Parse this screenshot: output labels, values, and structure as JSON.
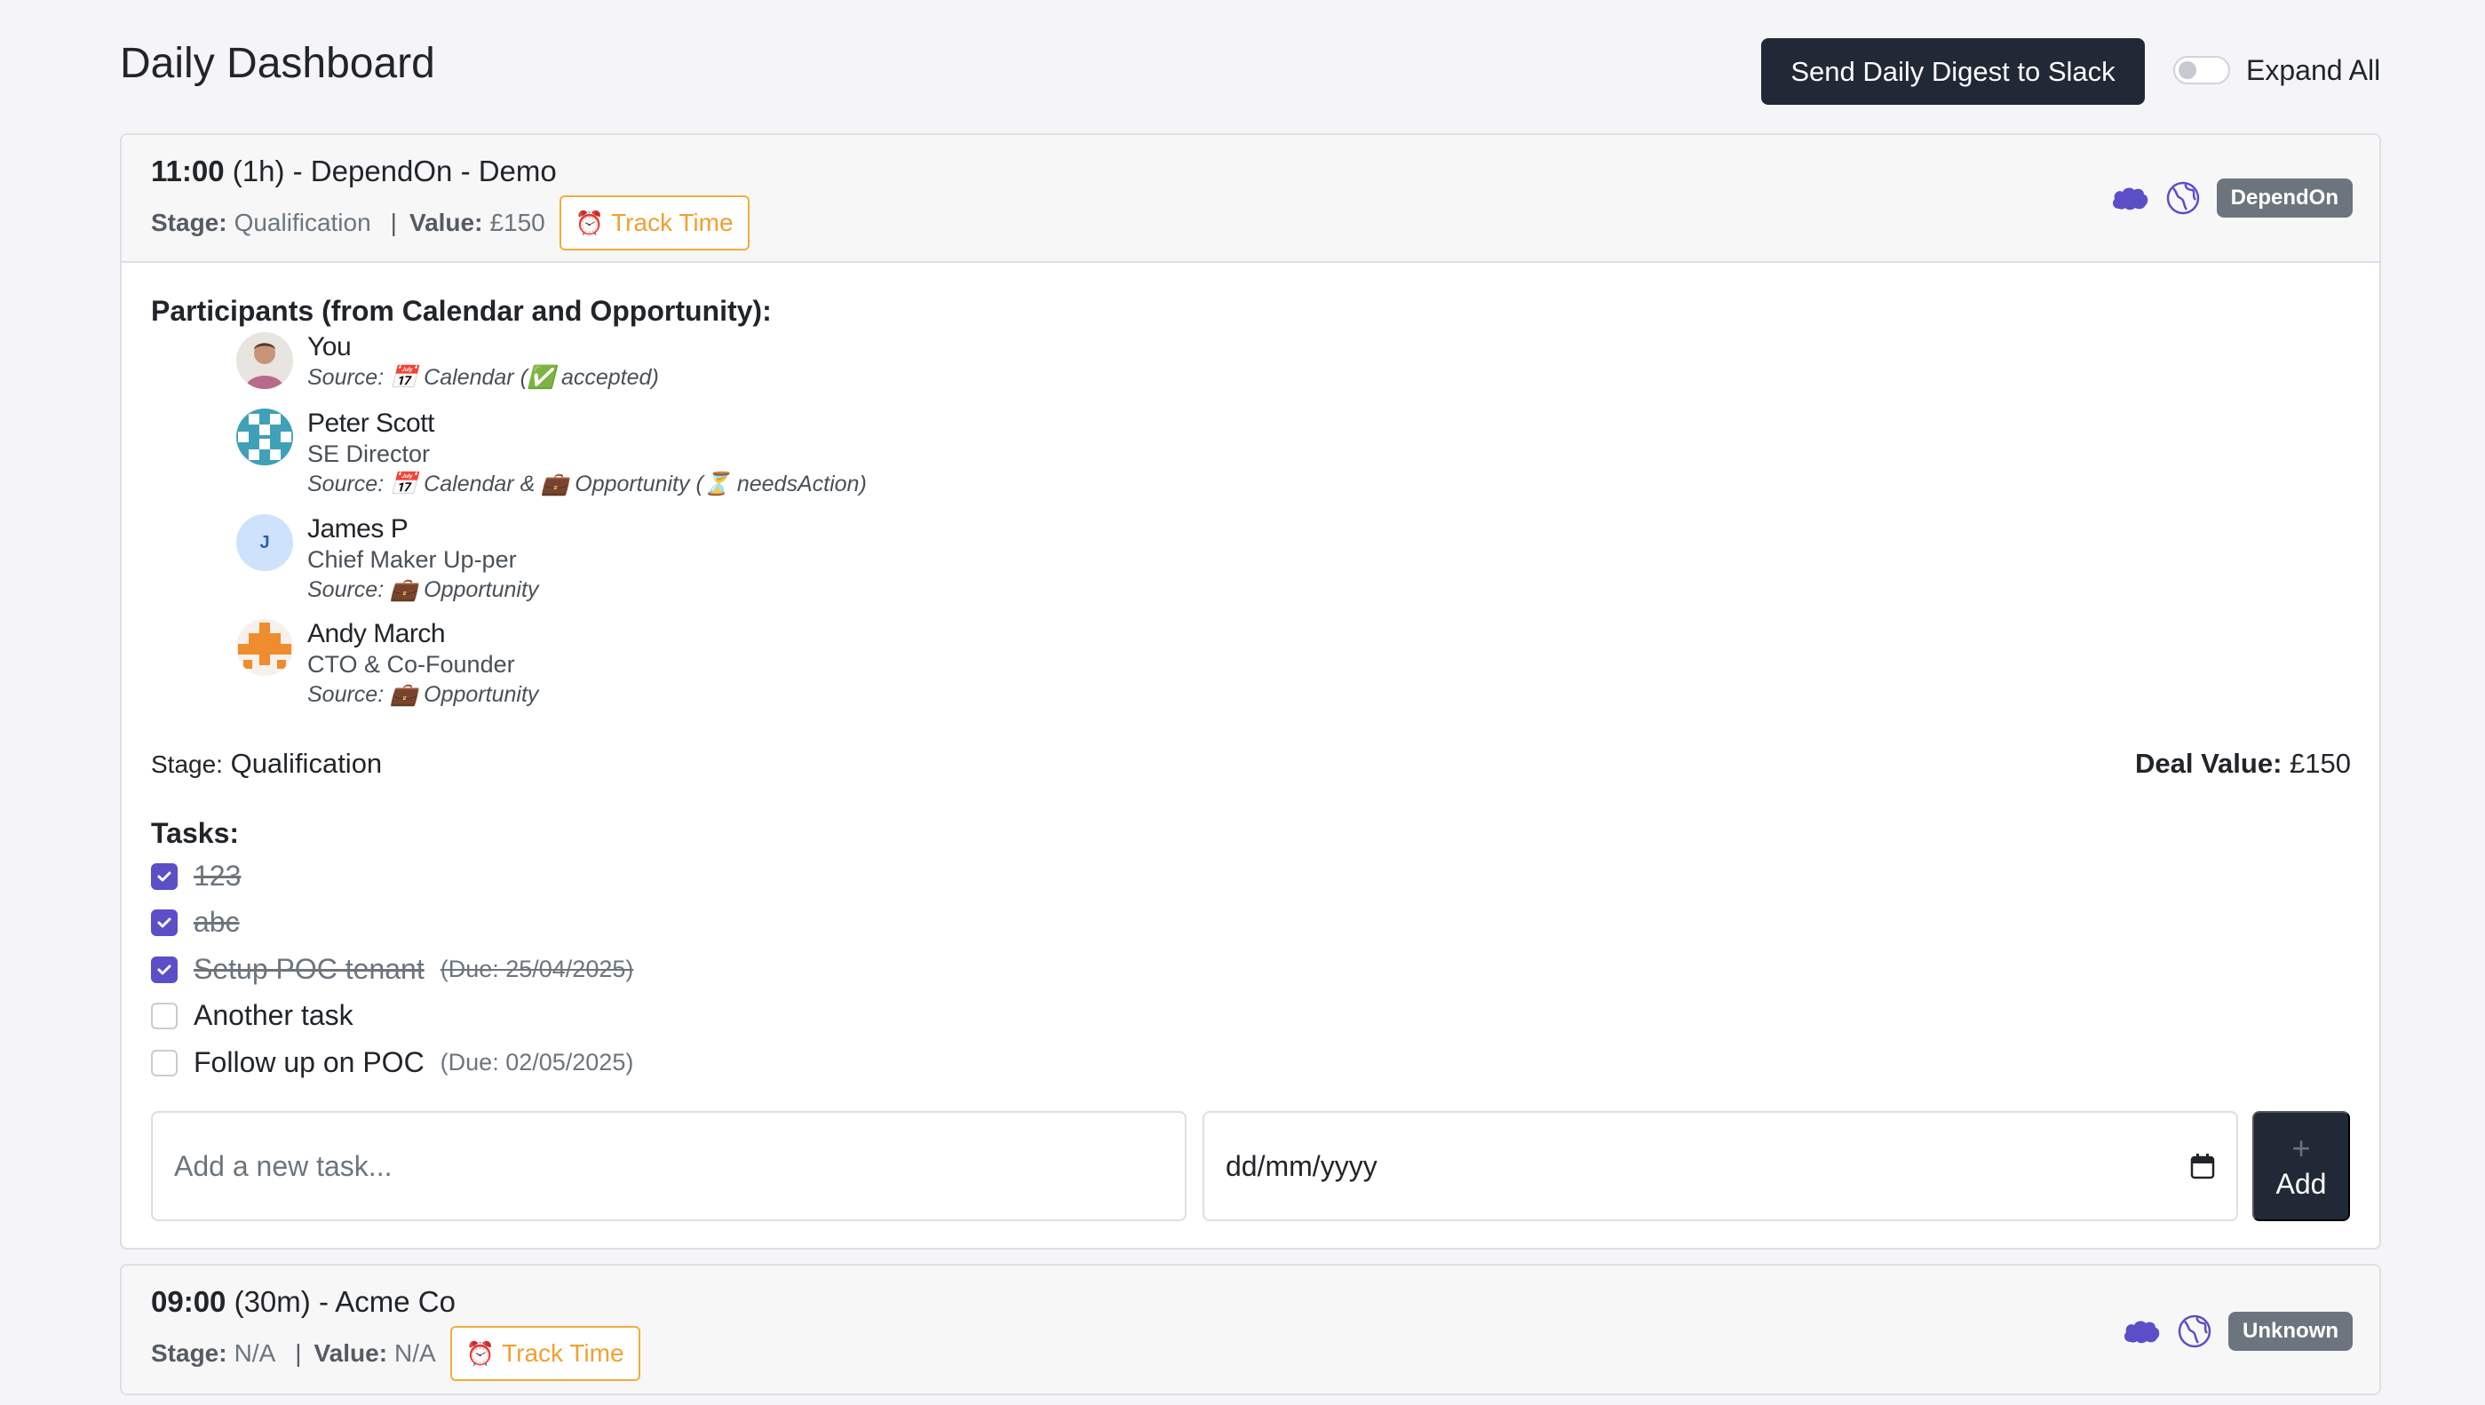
{
  "page": {
    "title": "Daily Dashboard",
    "digest_button": "Send Daily Digest to Slack",
    "expand_all_label": "Expand All",
    "expand_all_on": false
  },
  "meetings": [
    {
      "time": "11:00",
      "duration": "(1h)",
      "name": "- DependOn - Demo",
      "stage_label": "Stage:",
      "stage": "Qualification",
      "sep": "|",
      "value_label": "Value:",
      "value": "£150",
      "track_label": "Track Time",
      "account_badge": "DependOn",
      "participants_title": "Participants (from Calendar and Opportunity):",
      "participants": [
        {
          "name": "You",
          "role": "",
          "source": "Source: 📅 Calendar (✅ accepted)"
        },
        {
          "name": "Peter Scott",
          "role": "SE Director",
          "source": "Source: 📅 Calendar & 💼 Opportunity (⏳ needsAction)"
        },
        {
          "name": "James P",
          "role": "Chief Maker Up-per",
          "source": "Source: 💼 Opportunity",
          "initial": "J"
        },
        {
          "name": "Andy March",
          "role": "CTO & Co-Founder",
          "source": "Source: 💼 Opportunity"
        }
      ],
      "stage_row_label": "Stage:",
      "stage_row_value": "Qualification",
      "deal_value_label": "Deal Value:",
      "deal_value": "£150",
      "tasks_title": "Tasks:",
      "tasks": [
        {
          "text": "123",
          "done": true,
          "due": ""
        },
        {
          "text": "abc",
          "done": true,
          "due": ""
        },
        {
          "text": "Setup POC tenant",
          "done": true,
          "due": "(Due: 25/04/2025)"
        },
        {
          "text": "Another task",
          "done": false,
          "due": ""
        },
        {
          "text": "Follow up on POC",
          "done": false,
          "due": "(Due: 02/05/2025)"
        }
      ],
      "new_task_placeholder": "Add a new task...",
      "date_placeholder": "dd/mm/yyyy",
      "add_label": "Add",
      "add_icon": "+"
    },
    {
      "time": "09:00",
      "duration": "(30m)",
      "name": "- Acme Co",
      "stage_label": "Stage:",
      "stage": "N/A",
      "sep": "|",
      "value_label": "Value:",
      "value": "N/A",
      "track_label": "Track Time",
      "account_badge": "Unknown"
    }
  ],
  "icons": {
    "alarm": "⏰",
    "cloud": "salesforce-cloud-icon",
    "globe": "globe-icon",
    "calendar": "calendar-icon",
    "check": "check-icon"
  },
  "colors": {
    "dark_button": "#212836",
    "checkbox_checked": "#5b4fc7",
    "track_time": "#f0a030",
    "badge": "#6c757d",
    "icon_purple": "#5b4fc7"
  }
}
